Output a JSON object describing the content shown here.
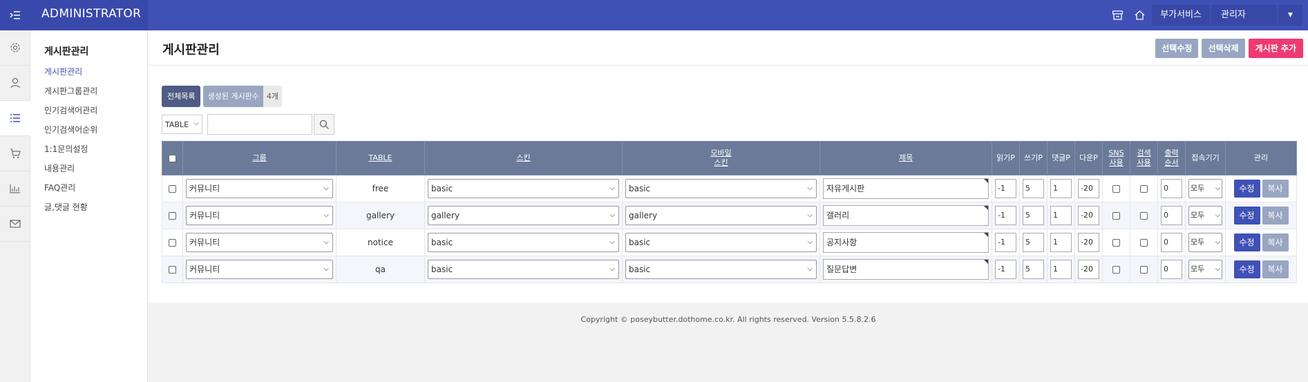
{
  "header": {
    "title": "ADMINISTRATOR",
    "addon_label": "부가서비스",
    "admin_label": "관리자"
  },
  "rail": [
    "gear-icon",
    "user-icon",
    "list-icon",
    "cart-icon",
    "chart-icon",
    "mail-icon"
  ],
  "subnav": {
    "title": "게시판관리",
    "items": [
      "게시판관리",
      "게시판그룹관리",
      "인기검색어관리",
      "인기검색어순위",
      "1:1문의설정",
      "내용관리",
      "FAQ관리",
      "글,댓글 현황"
    ]
  },
  "page": {
    "title": "게시판관리",
    "actions": {
      "edit_selected": "선택수정",
      "delete_selected": "선택삭제",
      "add_board": "게시판 추가"
    }
  },
  "counts": {
    "all_list": "전체목록",
    "created_label": "생성된 게시판수",
    "created_count": "4개"
  },
  "search": {
    "type_value": "TABLE",
    "query": ""
  },
  "table": {
    "headers": {
      "group": "그룹",
      "table": "TABLE",
      "skin": "스킨",
      "mobile_skin_1": "모바일",
      "mobile_skin_2": "스킨",
      "subject": "제목",
      "read_p": "읽기P",
      "write_p": "쓰기P",
      "comment_p": "댓글P",
      "down_p": "다운P",
      "sns_1": "SNS",
      "sns_2": "사용",
      "search_1": "검색",
      "search_2": "사용",
      "order_1": "출력",
      "order_2": "순서",
      "device": "접속기기",
      "manage": "관리"
    },
    "rows": [
      {
        "group": "커뮤니티",
        "table": "free",
        "skin": "basic",
        "mobile_skin": "basic",
        "subject": "자유게시판",
        "read": "-1",
        "write": "5",
        "comment": "1",
        "down": "-20",
        "order": "0",
        "device": "모두"
      },
      {
        "group": "커뮤니티",
        "table": "gallery",
        "skin": "gallery",
        "mobile_skin": "gallery",
        "subject": "갤러리",
        "read": "-1",
        "write": "5",
        "comment": "1",
        "down": "-20",
        "order": "0",
        "device": "모두"
      },
      {
        "group": "커뮤니티",
        "table": "notice",
        "skin": "basic",
        "mobile_skin": "basic",
        "subject": "공지사항",
        "read": "-1",
        "write": "5",
        "comment": "1",
        "down": "-20",
        "order": "0",
        "device": "모두"
      },
      {
        "group": "커뮤니티",
        "table": "qa",
        "skin": "basic",
        "mobile_skin": "basic",
        "subject": "질문답변",
        "read": "-1",
        "write": "5",
        "comment": "1",
        "down": "-20",
        "order": "0",
        "device": "모두"
      }
    ],
    "edit_label": "수정",
    "copy_label": "복사"
  },
  "footer": {
    "copyright": "Copyright © poseybutter.dothome.co.kr. All rights reserved. Version 5.5.8.2.6"
  }
}
